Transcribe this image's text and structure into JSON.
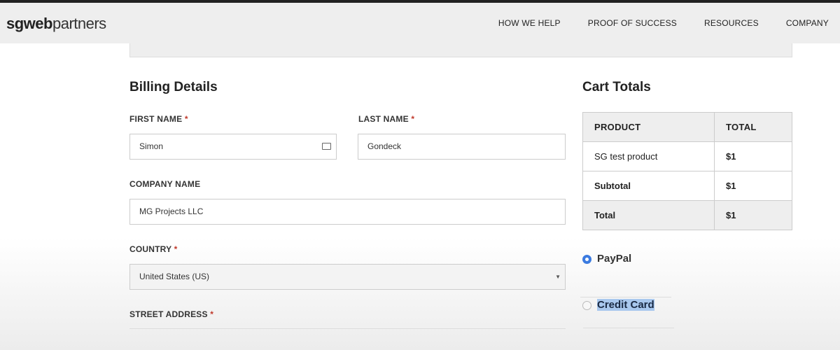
{
  "header": {
    "logo_bold": "sgweb",
    "logo_rest": "partners",
    "nav": [
      "HOW WE HELP",
      "PROOF OF SUCCESS",
      "RESOURCES",
      "COMPANY"
    ]
  },
  "billing": {
    "title": "Billing Details",
    "first_name": {
      "label": "FIRST NAME",
      "value": "Simon"
    },
    "last_name": {
      "label": "LAST NAME",
      "value": "Gondeck"
    },
    "company": {
      "label": "COMPANY NAME",
      "value": "MG Projects LLC"
    },
    "country": {
      "label": "COUNTRY",
      "value": "United States (US)"
    },
    "street": {
      "label": "STREET ADDRESS"
    },
    "required_mark": "*"
  },
  "cart": {
    "title": "Cart Totals",
    "headers": [
      "PRODUCT",
      "TOTAL"
    ],
    "rows": [
      [
        "SG test product",
        "$1"
      ],
      [
        "Subtotal",
        "$1"
      ],
      [
        "Total",
        "$1"
      ]
    ]
  },
  "payment": {
    "options": [
      {
        "label": "PayPal",
        "selected": true
      },
      {
        "label": "Credit Card",
        "selected": false,
        "highlighted": true
      }
    ],
    "accent": "#3b7be0"
  }
}
